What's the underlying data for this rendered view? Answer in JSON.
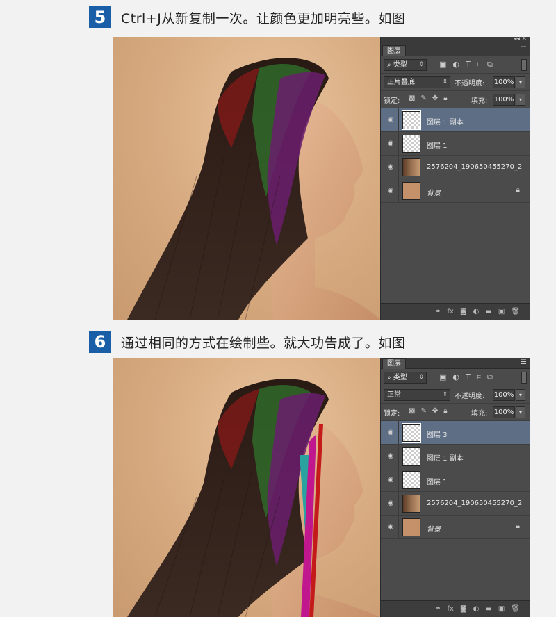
{
  "steps": [
    {
      "number": "5",
      "text": "Ctrl+J从新复制一次。让颜色更加明亮些。如图",
      "panel": {
        "tab": "图层",
        "filter": "类型",
        "blend_mode": "正片叠底",
        "opacity_label": "不透明度:",
        "opacity_value": "100%",
        "lock_label": "锁定:",
        "fill_label": "填充:",
        "fill_value": "100%",
        "layers": [
          {
            "name": "图层 1 副本",
            "thumb": "checker",
            "selected": true
          },
          {
            "name": "图层 1",
            "thumb": "checker",
            "selected": false
          },
          {
            "name": "2576204_190650455270_2",
            "thumb": "photo",
            "selected": false
          },
          {
            "name": "背景",
            "thumb": "bg",
            "selected": false,
            "locked": true
          }
        ]
      }
    },
    {
      "number": "6",
      "text": "通过相同的方式在绘制些。就大功告成了。如图",
      "panel": {
        "tab": "图层",
        "filter": "类型",
        "blend_mode": "正常",
        "opacity_label": "不透明度:",
        "opacity_value": "100%",
        "lock_label": "锁定:",
        "fill_label": "填充:",
        "fill_value": "100%",
        "layers": [
          {
            "name": "图层 3",
            "thumb": "checker",
            "selected": true
          },
          {
            "name": "图层 1 副本",
            "thumb": "checker",
            "selected": false
          },
          {
            "name": "图层 1",
            "thumb": "checker",
            "selected": false
          },
          {
            "name": "2576204_190650455270_2",
            "thumb": "photo",
            "selected": false
          },
          {
            "name": "背景",
            "thumb": "bg",
            "selected": false,
            "locked": true
          }
        ]
      }
    }
  ],
  "icons": {
    "eye": "eye-icon",
    "lock": "lock-icon",
    "link": "link-icon",
    "fx": "fx-icon",
    "mask": "mask-icon",
    "adjust": "adjustment-icon",
    "folder": "folder-icon",
    "new": "new-layer-icon",
    "trash": "trash-icon"
  }
}
